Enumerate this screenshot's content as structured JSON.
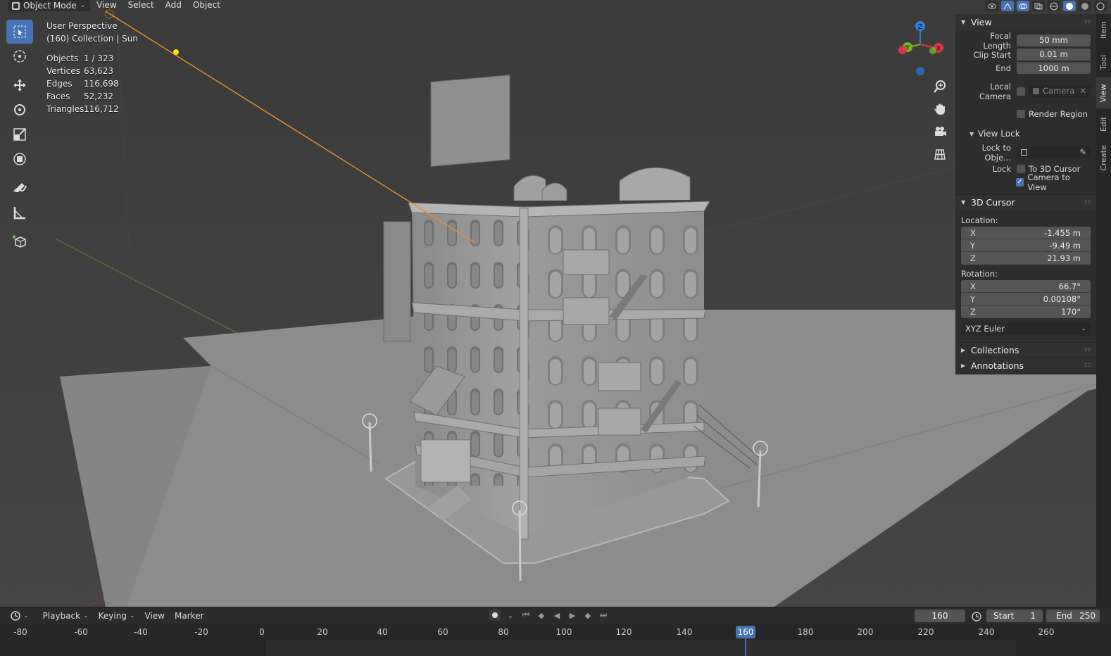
{
  "header": {
    "mode": "Object Mode",
    "menus": [
      "View",
      "Select",
      "Add",
      "Object"
    ]
  },
  "overlay": {
    "view_name": "User Perspective",
    "collection": "(160) Collection | Sun"
  },
  "stats": [
    {
      "label": "Objects",
      "value": "1 / 323"
    },
    {
      "label": "Vertices",
      "value": "63,623"
    },
    {
      "label": "Edges",
      "value": "116,698"
    },
    {
      "label": "Faces",
      "value": "52,232"
    },
    {
      "label": "Triangles",
      "value": "116,712"
    }
  ],
  "gizmo": {
    "x": "X",
    "y": "Y",
    "z": "Z"
  },
  "npanel": {
    "view": {
      "title": "View",
      "focal_length_label": "Focal Length",
      "focal_length": "50 mm",
      "clip_start_label": "Clip Start",
      "clip_start": "0.01 m",
      "end_label": "End",
      "clip_end": "1000 m",
      "local_camera_label": "Local Camera",
      "camera_placeholder": "Camera",
      "render_region_label": "Render Region",
      "view_lock_title": "View Lock",
      "lock_to_object_label": "Lock to Obje...",
      "lock_label": "Lock",
      "to_3d_cursor_label": "To 3D Cursor",
      "camera_to_view_label": "Camera to View"
    },
    "cursor": {
      "title": "3D Cursor",
      "location_label": "Location:",
      "location": [
        {
          "axis": "X",
          "value": "-1.455 m"
        },
        {
          "axis": "Y",
          "value": "-9.49 m"
        },
        {
          "axis": "Z",
          "value": "21.93 m"
        }
      ],
      "rotation_label": "Rotation:",
      "rotation": [
        {
          "axis": "X",
          "value": "66.7°"
        },
        {
          "axis": "Y",
          "value": "0.00108°"
        },
        {
          "axis": "Z",
          "value": "170°"
        }
      ],
      "rotation_mode": "XYZ Euler"
    },
    "collections_title": "Collections",
    "annotations_title": "Annotations"
  },
  "side_tabs": [
    "Item",
    "Tool",
    "View",
    "Edit",
    "Create"
  ],
  "timeline": {
    "menus": [
      "Playback",
      "Keying",
      "View",
      "Marker"
    ],
    "current_frame": "160",
    "start_label": "Start",
    "start": "1",
    "end_label": "End",
    "end": "250",
    "ruler": [
      "-80",
      "-60",
      "-40",
      "-20",
      "0",
      "20",
      "40",
      "60",
      "80",
      "100",
      "120",
      "140",
      "160",
      "180",
      "200",
      "220",
      "240",
      "260"
    ]
  },
  "colors": {
    "accent": "#4772b3",
    "panel": "#2d2d2d",
    "viewport": "#3d3d3d",
    "sun_line": "#e8902a",
    "gizmo_x": "#e0344a",
    "gizmo_y": "#74b821",
    "gizmo_z": "#2b7fe0"
  }
}
